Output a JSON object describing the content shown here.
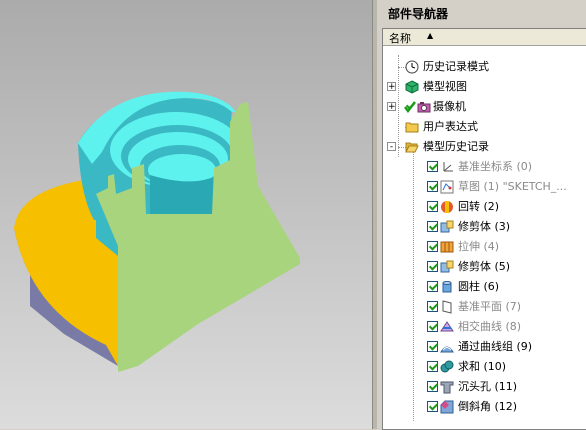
{
  "navigator": {
    "title": "部件导航器",
    "column_header": "名称",
    "top_nodes": [
      {
        "label": "历史记录模式",
        "icon": "clock-icon"
      },
      {
        "label": "模型视图",
        "icon": "model-views-icon",
        "expander": "+"
      },
      {
        "label": "摄像机",
        "icon": "camera-icon",
        "expander": "+"
      },
      {
        "label": "用户表达式",
        "icon": "folder-icon"
      },
      {
        "label": "模型历史记录",
        "icon": "folder-open-icon",
        "expander": "-"
      }
    ],
    "features": [
      {
        "label": "基准坐标系",
        "id": "(0)",
        "icon": "datum-csys-icon",
        "grayed": true
      },
      {
        "label": "草图",
        "id": "(1) \"SKETCH_...",
        "icon": "sketch-icon",
        "grayed": true
      },
      {
        "label": "回转",
        "id": "(2)",
        "icon": "revolve-icon",
        "grayed": false
      },
      {
        "label": "修剪体",
        "id": "(3)",
        "icon": "trim-body-icon",
        "grayed": false
      },
      {
        "label": "拉伸",
        "id": "(4)",
        "icon": "extrude-icon",
        "grayed": true
      },
      {
        "label": "修剪体",
        "id": "(5)",
        "icon": "trim-body-icon",
        "grayed": false
      },
      {
        "label": "圆柱",
        "id": "(6)",
        "icon": "cylinder-icon",
        "grayed": false
      },
      {
        "label": "基准平面",
        "id": "(7)",
        "icon": "datum-plane-icon",
        "grayed": true
      },
      {
        "label": "相交曲线",
        "id": "(8)",
        "icon": "intersection-curve-icon",
        "grayed": true
      },
      {
        "label": "通过曲线组",
        "id": "(9)",
        "icon": "through-curves-icon",
        "grayed": false
      },
      {
        "label": "求和",
        "id": "(10)",
        "icon": "unite-icon",
        "grayed": false
      },
      {
        "label": "沉头孔",
        "id": "(11)",
        "icon": "counterbore-hole-icon",
        "grayed": false
      },
      {
        "label": "倒斜角",
        "id": "(12)",
        "icon": "chamfer-icon",
        "grayed": false
      }
    ]
  },
  "colors": {
    "viewport_top": "#ababab",
    "cyan_face": "#5ef2ee",
    "green_face": "#a8d47e",
    "yellow_face": "#f6bf00",
    "purple_face": "#7a7aa6"
  }
}
